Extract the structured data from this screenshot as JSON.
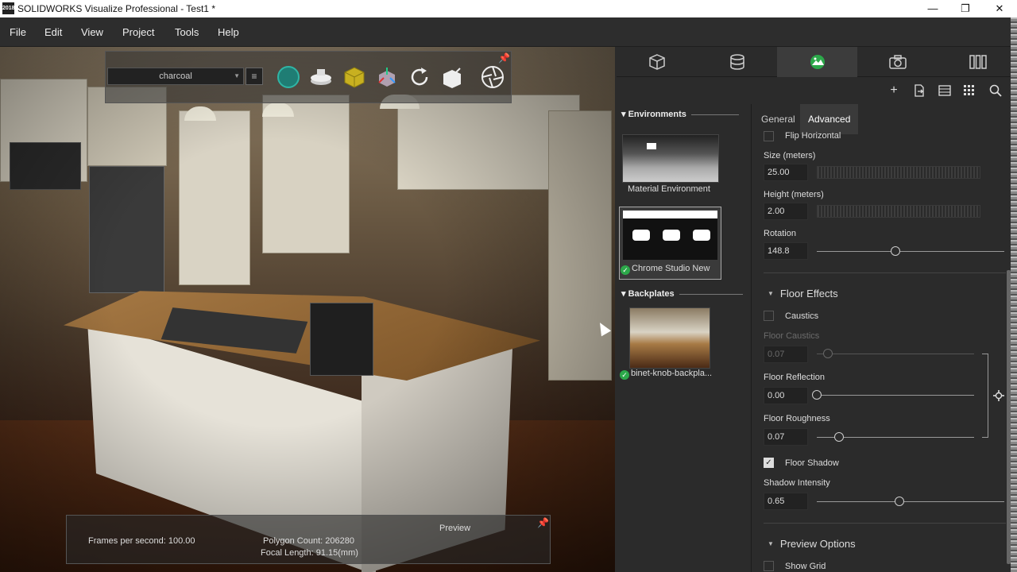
{
  "window": {
    "title": "SOLIDWORKS Visualize Professional - Test1 *",
    "icon": "2018",
    "minimize": "—",
    "restore": "❐",
    "close": "✕"
  },
  "menu": [
    "File",
    "Edit",
    "View",
    "Project",
    "Tools",
    "Help"
  ],
  "viewport_toolbar": {
    "material_select": "charcoal",
    "list_glyph": "≡"
  },
  "status": {
    "fps": "Frames per second: 100.00",
    "preview": "Preview",
    "polygon_count": "Polygon Count: 206280",
    "focal_length": "Focal Length: 91.15(mm)"
  },
  "palette_tabs": [
    "models-tab",
    "appearances-tab",
    "scenes-tab",
    "cameras-tab",
    "libraries-tab"
  ],
  "library": {
    "environments_header": "Environments",
    "environments": [
      {
        "label": "Material Environment",
        "checked": false
      },
      {
        "label": "Chrome Studio New",
        "checked": true
      }
    ],
    "backplates_header": "Backplates",
    "backplates": [
      {
        "label": "binet-knob-backpla...",
        "checked": true
      }
    ]
  },
  "properties": {
    "tabs": [
      "General",
      "Advanced"
    ],
    "active_tab": "Advanced",
    "flip_horizontal": "Flip Horizontal",
    "size_label": "Size (meters)",
    "size_value": "25.00",
    "height_label": "Height (meters)",
    "height_value": "2.00",
    "rotation_label": "Rotation",
    "rotation_value": "148.8",
    "rotation_fraction": 0.42,
    "floor_effects": "Floor Effects",
    "caustics": "Caustics",
    "caustics_checked": false,
    "floor_caustics_label": "Floor Caustics",
    "floor_caustics_value": "0.07",
    "floor_caustics_fraction": 0.07,
    "floor_reflection_label": "Floor Reflection",
    "floor_reflection_value": "0.00",
    "floor_reflection_fraction": 0.0,
    "floor_roughness_label": "Floor Roughness",
    "floor_roughness_value": "0.07",
    "floor_roughness_fraction": 0.14,
    "floor_shadow": "Floor Shadow",
    "floor_shadow_checked": true,
    "shadow_intensity_label": "Shadow Intensity",
    "shadow_intensity_value": "0.65",
    "shadow_intensity_fraction": 0.44,
    "preview_options": "Preview Options",
    "show_grid": "Show Grid"
  },
  "colors": {
    "accent_green": "#2ca84a",
    "panel_bg": "#2b2b2b",
    "active_tab": "#3c3c3c"
  }
}
